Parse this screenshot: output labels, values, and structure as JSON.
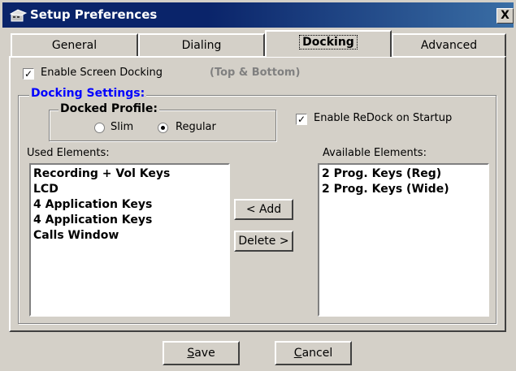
{
  "window": {
    "title": "Setup Preferences",
    "close_label": "X"
  },
  "tabs": [
    {
      "label": "General"
    },
    {
      "label": "Dialing"
    },
    {
      "label": "Docking"
    },
    {
      "label": "Advanced"
    }
  ],
  "docking": {
    "enable_screen_docking": {
      "label": "Enable Screen Docking",
      "checked": true
    },
    "position_hint": "(Top & Bottom)",
    "settings_title": "Docking Settings:",
    "profile": {
      "title": "Docked Profile:",
      "options": [
        {
          "label": "Slim",
          "selected": false
        },
        {
          "label": "Regular",
          "selected": true
        }
      ]
    },
    "redock": {
      "label": "Enable ReDock on Startup",
      "checked": true
    },
    "used_elements": {
      "label": "Used Elements:",
      "items": [
        "Recording + Vol Keys",
        "LCD",
        "4 Application Keys",
        "4 Application Keys",
        "Calls Window"
      ]
    },
    "available_elements": {
      "label": "Available Elements:",
      "items": [
        "2 Prog. Keys (Reg)",
        "2 Prog. Keys (Wide)"
      ]
    },
    "add_label": "< Add",
    "delete_label": "Delete >"
  },
  "footer": {
    "save_prefix": "",
    "save_u": "S",
    "save_rest": "ave",
    "cancel_prefix": "",
    "cancel_u": "C",
    "cancel_rest": "ancel"
  },
  "colors": {
    "titlebar": "#0a246a",
    "group_title": "#0000ff",
    "face": "#d4d0c8"
  }
}
